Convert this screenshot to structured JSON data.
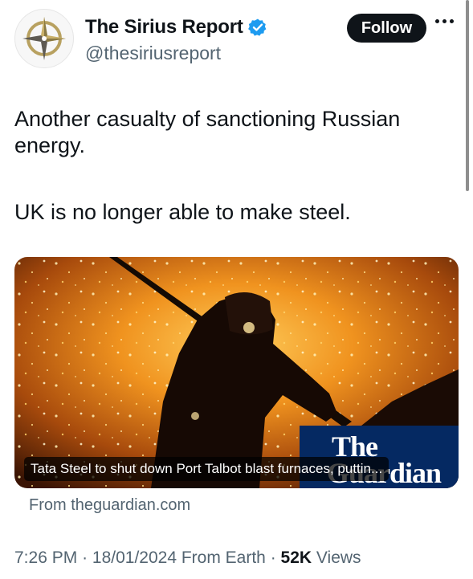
{
  "author": {
    "display_name": "The Sirius Report",
    "handle": "@thesiriusreport",
    "verified": true,
    "avatar_icon": "compass-star-logo"
  },
  "header": {
    "follow_label": "Follow",
    "more_icon": "more-dots-icon"
  },
  "tweet": {
    "text_line1": "Another casualty of sanctioning Russian energy.",
    "text_line2": "UK is no longer able to make steel."
  },
  "link_card": {
    "caption": "Tata Steel to shut down Port Talbot blast furnaces, puttin...",
    "logo_the": "The",
    "logo_name": "Guardian",
    "source": "From theguardian.com"
  },
  "meta": {
    "time": "7:26 PM",
    "date": "18/01/2024",
    "location": "From Earth",
    "views_count": "52K",
    "views_label": "Views"
  },
  "colors": {
    "text_primary": "#0f1419",
    "text_secondary": "#536471",
    "verified_blue": "#1d9bf0",
    "guardian_blue": "#052962"
  }
}
